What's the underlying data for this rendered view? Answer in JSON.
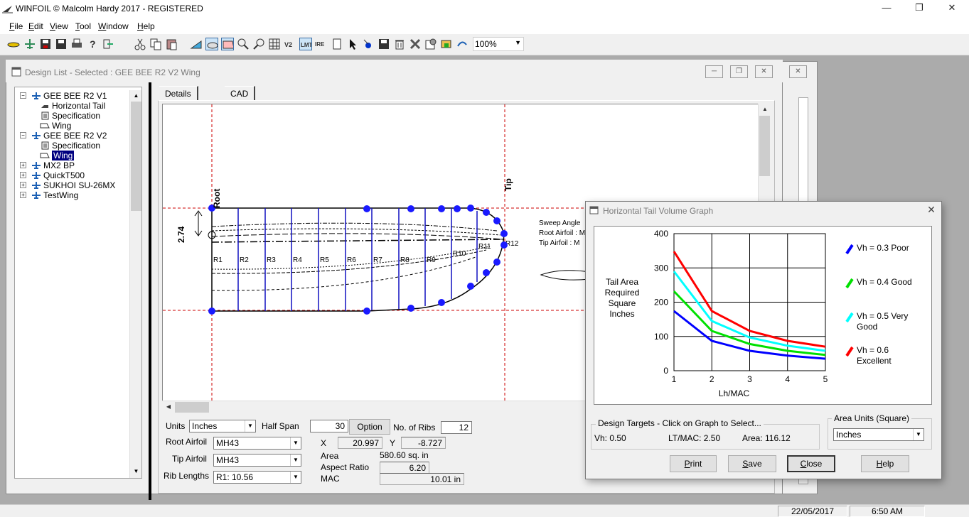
{
  "app": {
    "title": "WINFOIL © Malcolm Hardy 2017 - REGISTERED"
  },
  "menu": [
    "File",
    "Edit",
    "View",
    "Tool",
    "Window",
    "Help"
  ],
  "menu_access_keys": [
    "F",
    "E",
    "V",
    "T",
    "W",
    "H"
  ],
  "toolbar": {
    "zoom_value": "100%"
  },
  "child_window": {
    "title": "Design List - Selected : GEE BEE R2 V2 Wing"
  },
  "tree": [
    {
      "label": "GEE BEE R2 V1",
      "level": 0,
      "expander": "minus",
      "icon": "plane-icon"
    },
    {
      "label": "Horizontal Tail",
      "level": 1,
      "icon": "tail-icon"
    },
    {
      "label": "Specification",
      "level": 1,
      "icon": "spec-icon"
    },
    {
      "label": "Wing",
      "level": 1,
      "icon": "wing-icon"
    },
    {
      "label": "GEE BEE R2 V2",
      "level": 0,
      "expander": "minus",
      "icon": "plane-icon"
    },
    {
      "label": "Specification",
      "level": 1,
      "icon": "spec-icon"
    },
    {
      "label": "Wing",
      "level": 1,
      "icon": "wing-icon",
      "selected": true
    },
    {
      "label": "MX2 BP",
      "level": 0,
      "expander": "plus",
      "icon": "plane-icon"
    },
    {
      "label": "QuickT500",
      "level": 0,
      "expander": "plus",
      "icon": "plane-icon"
    },
    {
      "label": "SUKHOI SU-26MX",
      "level": 0,
      "expander": "plus",
      "icon": "plane-icon"
    },
    {
      "label": "TestWing",
      "level": 0,
      "expander": "plus",
      "icon": "plane-icon"
    }
  ],
  "tabs": [
    "Details",
    "CAD"
  ],
  "drawing": {
    "root_label": "Root",
    "tip_label": "Tip",
    "dimension": "2.74",
    "ribs": [
      "R1",
      "R2",
      "R3",
      "R4",
      "R5",
      "R6",
      "R7",
      "R8",
      "R9",
      "R10",
      "R11",
      "R12"
    ],
    "info": {
      "sweep": "Sweep Angle",
      "root_airfoil": "Root Airfoil : M",
      "tip_airfoil": "Tip Airfoil   : M"
    }
  },
  "form": {
    "units_label": "Units",
    "units_value": "Inches",
    "half_span_label": "Half Span",
    "half_span_value": "30",
    "option_button": "Option",
    "ribs_label": "No. of Ribs",
    "ribs_value": "12",
    "root_airfoil_label": "Root Airfoil",
    "root_airfoil_value": "MH43",
    "tip_airfoil_label": "Tip Airfoil",
    "tip_airfoil_value": "MH43",
    "rib_lengths_label": "Rib Lengths",
    "rib_lengths_value": "R1: 10.56",
    "x_label": "X",
    "x_value": "20.997",
    "y_label": "Y",
    "y_value": "-8.727",
    "area_label": "Area",
    "area_value": "580.60 sq. in",
    "aspect_label": "Aspect Ratio",
    "aspect_value": "6.20",
    "mac_label": "MAC",
    "mac_value": "10.01 in"
  },
  "dialog": {
    "title": "Horizontal Tail Volume Graph",
    "targets_group": "Design Targets - Click on Graph to Select...",
    "vh_text": "Vh: 0.50",
    "ltmac_text": "LT/MAC: 2.50",
    "area_text": "Area: 116.12",
    "units_group": "Area Units (Square)",
    "units_value": "Inches",
    "buttons": {
      "print": "Print",
      "save": "Save",
      "close": "Close",
      "help": "Help"
    },
    "button_access_keys": {
      "print": "P",
      "save": "S",
      "close": "C",
      "help": "H"
    }
  },
  "chart_data": {
    "type": "line",
    "title": "",
    "xlabel": "Lh/MAC",
    "ylabel": "Tail Area Required Square Inches",
    "ylabel_lines": [
      "Tail Area",
      "Required",
      "Square",
      "Inches"
    ],
    "x": [
      1,
      2,
      3,
      4,
      5
    ],
    "xlim": [
      1,
      5
    ],
    "ylim": [
      0,
      400
    ],
    "xticks": [
      "1",
      "2",
      "3",
      "4",
      "5"
    ],
    "yticks": [
      "0",
      "100",
      "200",
      "300",
      "400"
    ],
    "grid": true,
    "legend_position": "right",
    "series": [
      {
        "name": "Vh = 0.3 Poor",
        "legend_lines": [
          "Vh = 0.3 Poor"
        ],
        "color": "#0000ff",
        "values": [
          174,
          87,
          58,
          44,
          35
        ]
      },
      {
        "name": "Vh = 0.4 Good",
        "legend_lines": [
          "Vh = 0.4 Good"
        ],
        "color": "#00e000",
        "values": [
          232,
          116,
          78,
          58,
          46
        ]
      },
      {
        "name": "Vh = 0.5 Very Good",
        "legend_lines": [
          "Vh = 0.5 Very",
          "Good"
        ],
        "color": "#00ffff",
        "values": [
          290,
          145,
          97,
          73,
          58
        ]
      },
      {
        "name": "Vh = 0.6 Excellent",
        "legend_lines": [
          "Vh = 0.6",
          "Excellent"
        ],
        "color": "#ff0000",
        "values": [
          348,
          174,
          116,
          87,
          70
        ]
      }
    ]
  },
  "status": {
    "date": "22/05/2017",
    "time": "6:50 AM"
  }
}
